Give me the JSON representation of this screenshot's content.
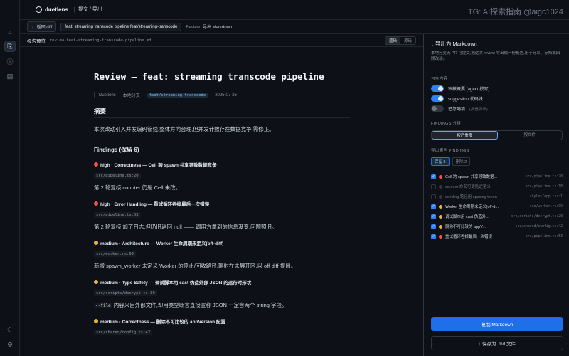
{
  "window": {
    "brand": "duetlens",
    "crumb": "提交 / 导出",
    "watermark": "TG: AI探索指南 @aigc1024"
  },
  "rail": {
    "icons": [
      "home-icon",
      "export-icon",
      "info-icon",
      "document-icon",
      "moon-icon",
      "settings-icon"
    ]
  },
  "subbar": {
    "back_label": "← 返回 diff",
    "branch_label": "feat: streaming transcode pipeline  feat/streaming-transcode",
    "context_review": "Review",
    "context_action": "导出 Markdown"
  },
  "preview": {
    "title": "报告预览",
    "filename": "review-feat-streaming-transcode-pipeline.md",
    "view_render": "渲染",
    "view_source": "源码"
  },
  "doc": {
    "h1": "Review — feat: streaming transcode pipeline",
    "meta_tool": "Duetlens",
    "meta_sep1": "·",
    "meta_branch": "本地分支",
    "meta_sep2": "·",
    "meta_tag": "feat/streaming-transcode",
    "meta_sep3": "·",
    "meta_date": "2025-07-26",
    "summary_heading": "摘要",
    "summary_text": "本次改动引入并发编码管线,整体方向合理,但并发计数存在数据竞争,需修正。",
    "findings_heading": "Findings (保留 6)",
    "findings": [
      {
        "severity": "high",
        "title": "high · Correctness — Cell 跨 spawn 共享导致数据竞争",
        "path": "src/pipeline.ts:20",
        "desc": "第 2 轮复核:counter 仍是 Cell,未改。",
        "desc_code": ""
      },
      {
        "severity": "high",
        "title": "high · Error Handling — 重试循环吞掉最后一次错误",
        "path": "src/pipeline.ts:53",
        "desc": "第 2 轮复核:加了日志,但仍旧返回 null —— 调用方拿到的信息没变,问题照旧。",
        "desc_code": ""
      },
      {
        "severity": "medium",
        "title": "medium · Architecture — Worker 生命周期未定义(off-diff)",
        "path": "src/worker.rs:99",
        "desc": "新增 spawn_worker 未定义 Worker 的停止/回收路径,辐射在未展开区,以 off-diff 提出。",
        "desc_code": ""
      },
      {
        "severity": "medium",
        "title": "medium · Type Safety — 调试脚本用 cast 伪造外部 JSON 的运行时形状",
        "path": "src/scripts/decrypt.ts:20",
        "desc": "内容来自外部文件,却用类型断言直接宣称 JSON 一定含两个 string 字段。",
        "desc_code": "--file"
      },
      {
        "severity": "medium",
        "title": "medium · Correctness — 删除不可比较的 appVersion 配置",
        "path": "src/shared/config.ts:42",
        "desc": "",
        "desc_code": ""
      }
    ]
  },
  "panel": {
    "title": "↓ 导出为 Markdown",
    "desc": "本地分支无 PR 可提交,把这次 review 导出成一份报告,用于分享、存档或回顾改动。",
    "include_label": "包含内容",
    "toggles": [
      {
        "label": "审核概要 (agent 撰写)",
        "hint": "",
        "on": true
      },
      {
        "label": "suggestion 代码块",
        "hint": "",
        "on": true
      },
      {
        "label": "已忽略项",
        "hint": "(折叠列出)",
        "on": false
      }
    ],
    "findings_label": "FINDINGS 分组",
    "group_by_severity": "按严重度",
    "group_by_file": "按文件",
    "export_items_label": "导出哪些 FINDINGS",
    "chip_keep": "保留 5",
    "chip_removed": "删除 2",
    "items": [
      {
        "checked": true,
        "severity": "high",
        "text": "Cell 跨 spawn 共享导致数据...",
        "path": "src/pipeline.ts:20",
        "dim": false
      },
      {
        "checked": false,
        "severity": "none",
        "text": "counter 命名可更贴近语义",
        "path": "src/pipeline.ts:18",
        "dim": true
      },
      {
        "checked": false,
        "severity": "none",
        "text": "seeding 路径用 spacing token",
        "path": "styles/app.css:1",
        "dim": true
      },
      {
        "checked": true,
        "severity": "medium",
        "text": "Worker 生命周期未定义(off-d...",
        "path": "src/worker.rs:99",
        "dim": false
      },
      {
        "checked": true,
        "severity": "medium",
        "text": "调试脚本用 cast 伪造外...",
        "path": "src/scripts/decrypt.ts:20",
        "dim": false
      },
      {
        "checked": true,
        "severity": "medium",
        "text": "删除不可比较的 appV...",
        "path": "src/shared/config.ts:42",
        "dim": false
      },
      {
        "checked": true,
        "severity": "high",
        "text": "重试循环吞掉最后一次错误",
        "path": "src/pipeline.ts:53",
        "dim": false
      }
    ],
    "copy_button": "复制 Markdown",
    "save_button": "↓ 保存为 .md 文件"
  },
  "colors": {
    "accent": "#1f6feb",
    "high": "#f85149",
    "medium": "#e3b341",
    "background": "#0d1117"
  }
}
